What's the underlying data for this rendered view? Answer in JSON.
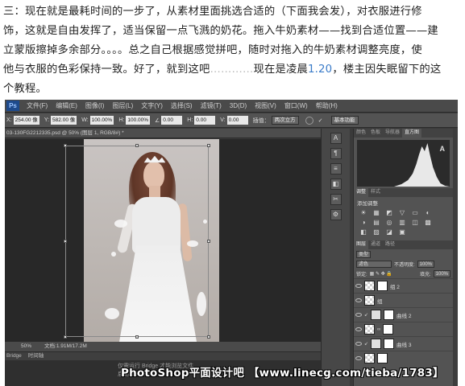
{
  "article": {
    "line1": "三：现在就是最耗时间的一步了，从素材里面挑选合适的（下面我会发），对衣服进行修",
    "line2": "饰，这就是自由发挥了，适当保留一点飞溅的奶花。拖入牛奶素材——找到合适位置——建",
    "line3": "立蒙版擦掉多余部分。。。。总之自己根据感觉拼吧，随时对拖入的牛奶素材调整亮度，使",
    "line4_a": "他与衣服的色彩保持一致。好了，就到这吧",
    "line4_dots": "…………",
    "line4_b": "现在是凌晨",
    "line4_time": "1.20",
    "line4_c": "，楼主因失眠留下的这",
    "line5": "个教程。"
  },
  "photoshop": {
    "logo": "Ps",
    "menu": [
      "文件(F)",
      "编辑(E)",
      "图像(I)",
      "图层(L)",
      "文字(Y)",
      "选择(S)",
      "滤镜(T)",
      "3D(D)",
      "视图(V)",
      "窗口(W)",
      "帮助(H)"
    ],
    "options": {
      "x_label": "X:",
      "x_value": "254.00 像",
      "y_label": "Y:",
      "y_value": "582.00 像",
      "w_label": "W:",
      "w_value": "100.00%",
      "h_label": "H:",
      "h_value": "100.00%",
      "angle_value": "0.00",
      "hskew_label": "H:",
      "hskew_value": "0.00",
      "vskew_label": "V:",
      "vskew_value": "0.00",
      "interp_label": "插值：",
      "interp_value": "两次立方",
      "workspace": "基本功能"
    },
    "doc_tab": "03-130FG2212335.psd @ 50% (图层 1, RGB/8#) *",
    "status": {
      "zoom": "50%",
      "doc_info": "文档:1.91M/17.2M"
    },
    "bridge_tabs": [
      "Bridge",
      "时间轴"
    ],
    "bridge_watermark_line1": "仅需运行 Bridge 才能浏览文件",
    "bridge_watermark_line2": "启动 Bridge",
    "left_dock_icons": [
      "A",
      "¶",
      "≡",
      "◧",
      "✂",
      "⚙"
    ],
    "right_panel": {
      "top_tabs": [
        "颜色",
        "色板",
        "导航器",
        "直方图"
      ],
      "histogram_label": "A",
      "mid_tabs": [
        "调整",
        "样式"
      ],
      "adj_title": "添加调整",
      "adj_icons": [
        "☀",
        "▦",
        "◩",
        "▽",
        "▭",
        "◐",
        "◑",
        "▤",
        "◎",
        "▥",
        "◫",
        "▩",
        "◧",
        "▨",
        "◪",
        "▣"
      ],
      "layer_tabs": [
        "图层",
        "通道",
        "路径"
      ],
      "kind_label": "类型",
      "blend_mode": "滤色",
      "opacity_label": "不透明度:",
      "opacity_value": "100%",
      "lock_label": "锁定:",
      "fill_label": "填充:",
      "fill_value": "100%",
      "layers": [
        {
          "name": "组 2",
          "type": "group"
        },
        {
          "name": "组",
          "type": "normal"
        },
        {
          "name": "曲线 2",
          "type": "adjust"
        },
        {
          "name": "",
          "type": "normal"
        },
        {
          "name": "曲线 3",
          "type": "adjust"
        },
        {
          "name": "",
          "type": "normal"
        }
      ]
    }
  },
  "watermark": "PhotoShop平面设计吧 【www.linecg.com/tieba/1783】"
}
